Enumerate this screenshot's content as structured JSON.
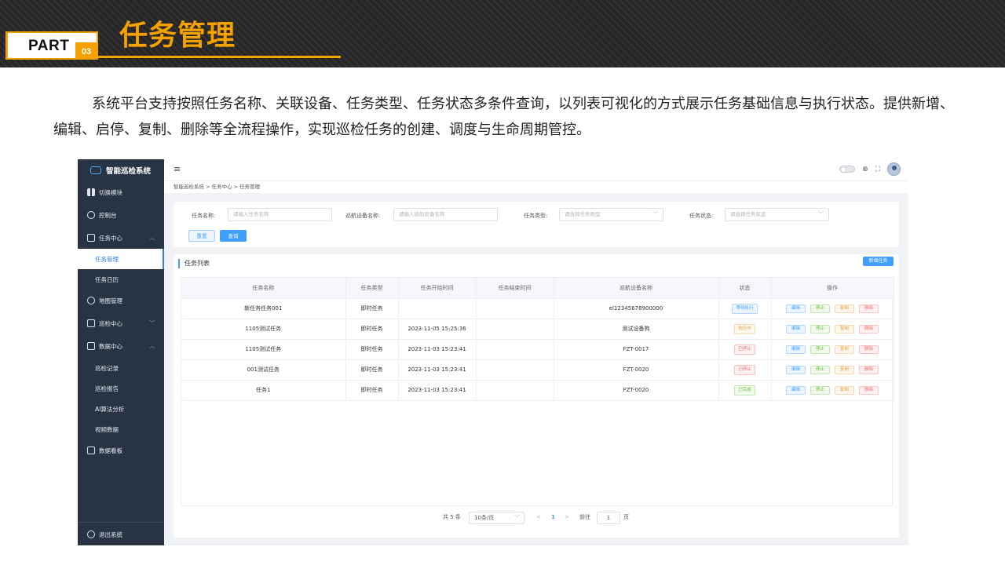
{
  "slide": {
    "part_label": "PART",
    "part_number": "03",
    "title": "任务管理",
    "intro": "系统平台支持按照任务名称、关联设备、任务类型、任务状态多条件查询，以列表可视化的方式展示任务基础信息与执行状态。提供新增、编辑、启停、复制、删除等全流程操作，实现巡检任务的创建、调度与生命周期管控。",
    "accent_color": "#f5a100"
  },
  "app": {
    "name": "智能巡检系统",
    "sidebar": {
      "switch_module": "切换模块",
      "dashboard": "控制台",
      "task_center": "任务中心",
      "task_manage": "任务管理",
      "task_calendar": "任务日历",
      "map_manage": "地图管理",
      "patrol_center": "巡检中心",
      "data_center": "数据中心",
      "patrol_records": "巡检记录",
      "patrol_report": "巡检报告",
      "ai_analysis": "AI算法分析",
      "video_data": "视频数据",
      "data_board": "数据看板",
      "logout": "退出系统"
    },
    "topbar": {
      "menu_icon": "≡",
      "globe_icon": "⊕",
      "fullscreen_icon": "⛶"
    },
    "breadcrumb": "智能巡检系统  >  任务中心  >  任务管理",
    "filters": {
      "task_name_label": "任务名称:",
      "task_name_placeholder": "请输入任务名称",
      "device_label": "巡航设备名称:",
      "device_placeholder": "请输入巡航设备名称",
      "type_label": "任务类型:",
      "type_placeholder": "请选择任务类型",
      "status_label": "任务状态:",
      "status_placeholder": "请选择任务状态",
      "reset_label": "重置",
      "search_label": "查询"
    },
    "table": {
      "title": "任务列表",
      "add_label": "新增任务",
      "headers": [
        "任务名称",
        "任务类型",
        "任务开始时间",
        "任务结束时间",
        "巡航设备名称",
        "状态",
        "操作"
      ],
      "rows": [
        {
          "name": "新任务任务001",
          "type": "即时任务",
          "start": "",
          "end": "",
          "device": "el12345678900000",
          "status": "等待执行",
          "status_kind": "waiting"
        },
        {
          "name": "1105测试任务",
          "type": "即时任务",
          "start": "2023-11-05 15:25:36",
          "end": "",
          "device": "测试设备狗",
          "status": "执行中",
          "status_kind": "running"
        },
        {
          "name": "1105测试任务",
          "type": "即时任务",
          "start": "2023-11-03 15:23:41",
          "end": "",
          "device": "FZT-0017",
          "status": "已停止",
          "status_kind": "stopped"
        },
        {
          "name": "001测试任务",
          "type": "即时任务",
          "start": "2023-11-03 15:23:41",
          "end": "",
          "device": "FZT-0020",
          "status": "已停止",
          "status_kind": "stopped"
        },
        {
          "name": "任务1",
          "type": "即时任务",
          "start": "2023-11-03 15:23:41",
          "end": "",
          "device": "FZT-0020",
          "status": "已完成",
          "status_kind": "done"
        }
      ],
      "actions": {
        "edit": "编辑",
        "stop": "停止",
        "copy": "复制",
        "delete": "删除"
      }
    },
    "pagination": {
      "total": "共 5 条",
      "page_size": "10条/页",
      "prev": "<",
      "current_page": "1",
      "next": ">",
      "goto_label": "前往",
      "goto_value": "1",
      "page_suffix": "页"
    }
  }
}
